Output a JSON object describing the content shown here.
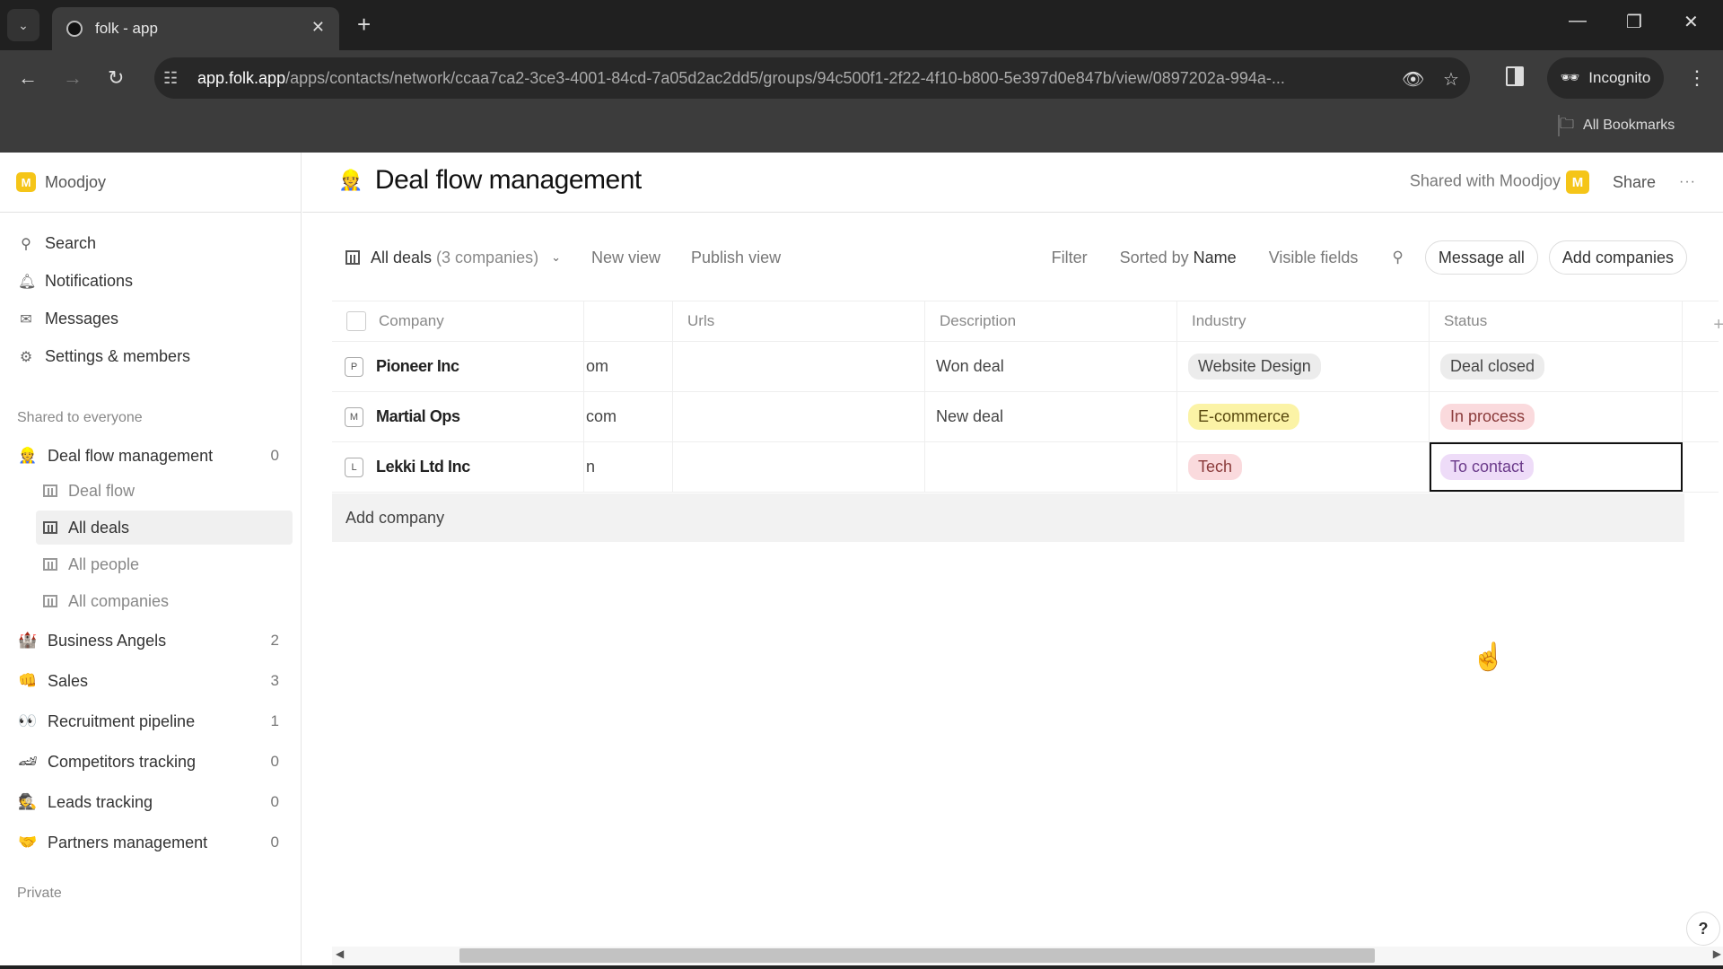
{
  "browser": {
    "tab_title": "folk - app",
    "url_host": "app.folk.app",
    "url_path": "/apps/contacts/network/ccaa7ca2-3ce3-4001-84cd-7a05d2ac2dd5/groups/94c500f1-2f22-4f10-b800-5e397d0e847b/view/0897202a-994a-...",
    "incognito_label": "Incognito",
    "bookmarks_label": "All Bookmarks"
  },
  "sidebar": {
    "workspace": {
      "initial": "M",
      "name": "Moodjoy"
    },
    "nav": [
      {
        "icon": "search-icon",
        "glyph": "⚲",
        "label": "Search"
      },
      {
        "icon": "bell-icon",
        "glyph": "🔔︎",
        "label": "Notifications"
      },
      {
        "icon": "mail-icon",
        "glyph": "✉",
        "label": "Messages"
      },
      {
        "icon": "gear-icon",
        "glyph": "⚙",
        "label": "Settings & members"
      }
    ],
    "shared_label": "Shared to everyone",
    "groups": [
      {
        "emoji": "👷",
        "label": "Deal flow management",
        "count": "0",
        "views": [
          {
            "label": "Deal flow",
            "active": false
          },
          {
            "label": "All deals",
            "active": true
          },
          {
            "label": "All people",
            "active": false
          },
          {
            "label": "All companies",
            "active": false
          }
        ]
      },
      {
        "emoji": "🏰",
        "label": "Business Angels",
        "count": "2"
      },
      {
        "emoji": "👊",
        "label": "Sales",
        "count": "3"
      },
      {
        "emoji": "👀",
        "label": "Recruitment pipeline",
        "count": "1"
      },
      {
        "emoji": "🏎",
        "label": "Competitors tracking",
        "count": "0"
      },
      {
        "emoji": "🕵",
        "label": "Leads tracking",
        "count": "0"
      },
      {
        "emoji": "🤝",
        "label": "Partners management",
        "count": "0"
      }
    ],
    "private_label": "Private"
  },
  "header": {
    "emoji": "👷",
    "title": "Deal flow management",
    "shared_with": "Shared with Moodjoy",
    "shared_avatar": "M",
    "share_label": "Share",
    "more_label": "···"
  },
  "toolbar": {
    "view_name": "All deals",
    "view_count": "(3 companies)",
    "new_view": "New view",
    "publish_view": "Publish view",
    "filter": "Filter",
    "sorted_prefix": "Sorted by",
    "sorted_field": "Name",
    "visible_fields": "Visible fields",
    "message_all": "Message all",
    "add_companies": "Add companies"
  },
  "table": {
    "columns": [
      "Company",
      "",
      "Urls",
      "Description",
      "Industry",
      "Status"
    ],
    "rows": [
      {
        "initial": "P",
        "company": "Pioneer Inc",
        "partial": "om",
        "urls": "",
        "description": "Won deal",
        "industry": {
          "label": "Website Design",
          "bg": "#ececec",
          "fg": "#444"
        },
        "status": {
          "label": "Deal closed",
          "bg": "#ececec",
          "fg": "#444"
        }
      },
      {
        "initial": "M",
        "company": "Martial Ops",
        "partial": "com",
        "urls": "",
        "description": "New deal",
        "industry": {
          "label": "E-commerce",
          "bg": "#fbf3a6",
          "fg": "#5a4a10"
        },
        "status": {
          "label": "In process",
          "bg": "#fadadd",
          "fg": "#8a3a3a"
        }
      },
      {
        "initial": "L",
        "company": "Lekki Ltd Inc",
        "partial": "n",
        "urls": "",
        "description": "",
        "industry": {
          "label": "Tech",
          "bg": "#fadadd",
          "fg": "#8a3a3a"
        },
        "status": {
          "label": "To contact",
          "bg": "#eedcf8",
          "fg": "#6b3a8a"
        }
      }
    ],
    "add_company": "Add company"
  },
  "help_label": "?"
}
